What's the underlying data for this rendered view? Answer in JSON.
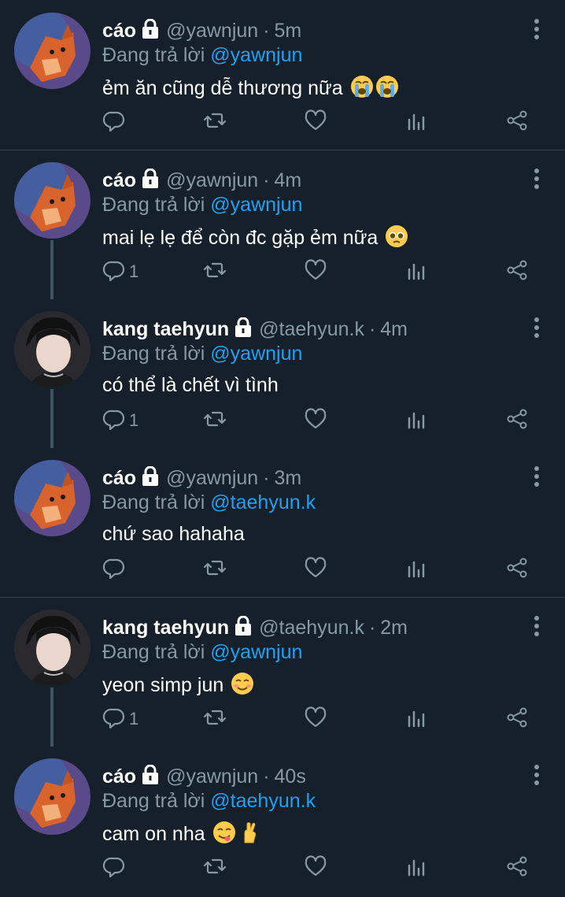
{
  "colors": {
    "background": "#15202b",
    "mention": "#1da1f2",
    "secondary": "#8899a6",
    "divider": "#38444d"
  },
  "replying_prefix": "Đang trả lời",
  "tweets": [
    {
      "name": "cáo",
      "handle": "@yawnjun",
      "time": "5m",
      "reply_to": "@yawnjun",
      "text": "ẻm ăn cũng dễ thương nữa",
      "emojis": [
        "loudly-crying-face-emoji",
        "loudly-crying-face-emoji"
      ],
      "reply_count": "",
      "avatar": "fox-avatar"
    },
    {
      "name": "cáo",
      "handle": "@yawnjun",
      "time": "4m",
      "reply_to": "@yawnjun",
      "text": "mai lẹ lẹ để còn đc gặp ẻm nữa",
      "emojis": [
        "pleading-face-emoji"
      ],
      "reply_count": "1",
      "avatar": "fox-avatar"
    },
    {
      "name": "kang taehyun",
      "handle": "@taehyun.k",
      "time": "4m",
      "reply_to": "@yawnjun",
      "text": "có thể là chết vì tình",
      "emojis": [],
      "reply_count": "1",
      "avatar": "person-avatar"
    },
    {
      "name": "cáo",
      "handle": "@yawnjun",
      "time": "3m",
      "reply_to": "@taehyun.k",
      "text": "chứ sao hahaha",
      "emojis": [],
      "reply_count": "",
      "avatar": "fox-avatar"
    },
    {
      "name": "kang taehyun",
      "handle": "@taehyun.k",
      "time": "2m",
      "reply_to": "@yawnjun",
      "text": "yeon simp jun",
      "emojis": [
        "smiling-face-emoji"
      ],
      "reply_count": "1",
      "avatar": "person-avatar"
    },
    {
      "name": "cáo",
      "handle": "@yawnjun",
      "time": "40s",
      "reply_to": "@taehyun.k",
      "text": "cam on nha",
      "emojis": [
        "savoring-food-emoji",
        "crossed-fingers-emoji"
      ],
      "reply_count": "",
      "avatar": "fox-avatar"
    }
  ]
}
